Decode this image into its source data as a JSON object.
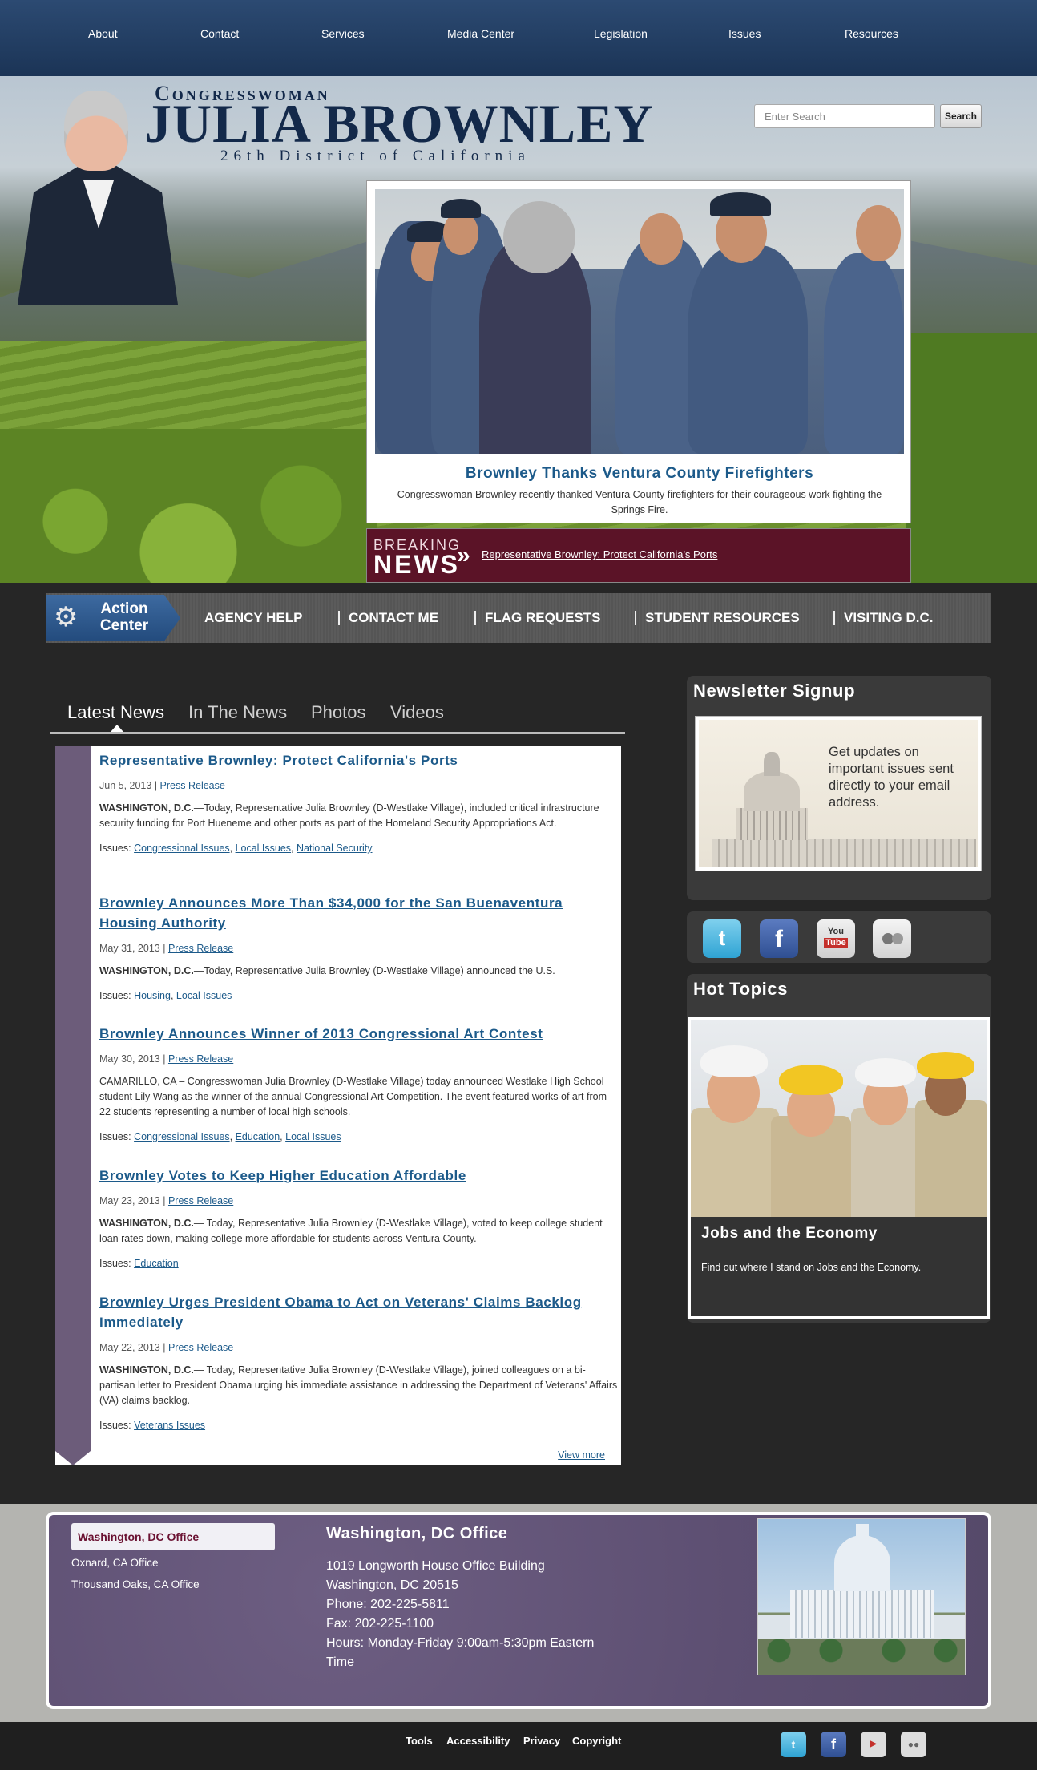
{
  "nav": [
    "About",
    "Contact",
    "Services",
    "Media Center",
    "Legislation",
    "Issues",
    "Resources"
  ],
  "header": {
    "title_small": "Congresswoman",
    "title_big": "JULIA BROWNLEY",
    "district": "26th District of California"
  },
  "search": {
    "placeholder": "Enter Search",
    "button": "Search"
  },
  "slide": {
    "title": "Brownley Thanks Ventura County Firefighters",
    "caption": "Congresswoman Brownley recently thanked Ventura County firefighters for their courageous work fighting the Springs Fire."
  },
  "breaking": {
    "word1": "BREAKING",
    "word2": "NEWS",
    "link": "Representative Brownley: Protect California's Ports"
  },
  "action": {
    "center_line1": "Action",
    "center_line2": "Center",
    "items": [
      "AGENCY HELP",
      "CONTACT ME",
      "FLAG REQUESTS",
      "STUDENT RESOURCES",
      "VISITING D.C."
    ]
  },
  "news_tabs": [
    "Latest News",
    "In The News",
    "Photos",
    "Videos"
  ],
  "articles": [
    {
      "title": "Representative Brownley: Protect California's Ports",
      "date": "Jun 5, 2013",
      "type": "Press Release",
      "lead": "WASHINGTON, D.C.",
      "body": "—Today, Representative Julia Brownley (D-Westlake Village), included critical infrastructure security funding for Port Hueneme and other ports as part of the Homeland Security Appropriations Act.",
      "issues": [
        "Congressional Issues",
        "Local Issues",
        "National Security"
      ]
    },
    {
      "title": "Brownley Announces More Than $34,000 for the San Buenaventura Housing Authority",
      "date": "May 31, 2013",
      "type": "Press Release",
      "lead": "WASHINGTON, D.C.",
      "body": "—Today, Representative Julia Brownley (D-Westlake Village) announced the U.S.",
      "issues": [
        "Housing",
        "Local Issues"
      ]
    },
    {
      "title": "Brownley Announces Winner of 2013 Congressional Art Contest",
      "date": "May 30, 2013",
      "type": "Press Release",
      "lead": "",
      "body": "CAMARILLO, CA – Congresswoman Julia Brownley (D-Westlake Village) today announced Westlake High School student Lily Wang as the winner of the annual Congressional Art Competition. The event featured works of art from 22 students representing a number of local high schools.",
      "issues": [
        "Congressional Issues",
        "Education",
        "Local Issues"
      ]
    },
    {
      "title": "Brownley Votes to Keep Higher Education Affordable",
      "date": "May 23, 2013",
      "type": "Press Release",
      "lead": "WASHINGTON, D.C.",
      "body": "— Today, Representative Julia Brownley (D-Westlake Village), voted to keep college student loan rates down, making college more affordable for students across Ventura County.",
      "issues": [
        "Education"
      ]
    },
    {
      "title": "Brownley Urges President Obama to Act on Veterans' Claims Backlog Immediately",
      "date": "May 22, 2013",
      "type": "Press Release",
      "lead": "WASHINGTON, D.C.",
      "body": "— Today, Representative Julia Brownley (D-Westlake Village), joined colleagues on a bi-partisan letter to President Obama urging his immediate assistance in addressing the Department of Veterans' Affairs (VA) claims backlog.",
      "issues": [
        "Veterans Issues"
      ]
    }
  ],
  "issues_label": "Issues:",
  "view_more": "View more",
  "newsletter": {
    "title": "Newsletter Signup",
    "image_text": "Get updates on important issues sent directly to your email address."
  },
  "social": [
    "twitter-icon",
    "facebook-icon",
    "youtube-icon",
    "flickr-icon"
  ],
  "hot_topics": {
    "title": "Hot Topics",
    "card_title": "Jobs and the Economy",
    "card_text": "Find out where I stand on Jobs and the Economy."
  },
  "offices": {
    "tabs": [
      "Washington, DC Office",
      "Oxnard, CA Office",
      "Thousand Oaks, CA Office"
    ],
    "heading": "Washington, DC Office",
    "lines": [
      "1019 Longworth House Office Building",
      "Washington, DC 20515",
      "Phone: 202-225-5811",
      "Fax: 202-225-1100",
      "Hours: Monday-Friday 9:00am-5:30pm Eastern Time"
    ]
  },
  "footer_links": [
    "Tools",
    "Accessibility",
    "Privacy",
    "Copyright"
  ],
  "colors": {
    "nav": "#1b3456",
    "accent_link": "#1c5a8a",
    "breaking": "#5b1327",
    "office": "#5d4f72"
  }
}
